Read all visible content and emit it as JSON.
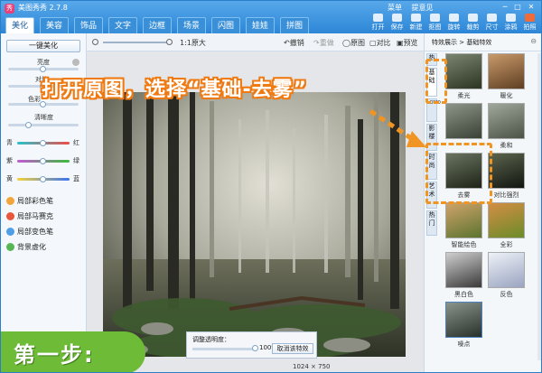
{
  "app": {
    "title": "美图秀秀 2.7.8",
    "logo_letter": "秀"
  },
  "top_links": [
    "菜单",
    "提意见"
  ],
  "window_controls": [
    "─",
    "□",
    "✕"
  ],
  "main_tabs": [
    "美化",
    "美容",
    "饰品",
    "文字",
    "边框",
    "场景",
    "闪图",
    "娃娃",
    "拼图"
  ],
  "toolbar_buttons": [
    "打开",
    "保存",
    "新建",
    "抠图",
    "旋转",
    "裁剪",
    "尺寸",
    "涂鸦",
    "拍照"
  ],
  "left_panel": {
    "onekey_label": "一键美化",
    "sliders": [
      {
        "label": "亮度",
        "level": 0.5
      },
      {
        "label": "对比",
        "level": 0.5
      },
      {
        "label": "色彩",
        "level": 0.5
      },
      {
        "label": "清晰度",
        "level": 0.3
      }
    ],
    "color_sliders": [
      {
        "left": "青",
        "right": "红",
        "level": 0.5,
        "gradient": "linear-gradient(90deg,#27c3c9,#f04a4a)"
      },
      {
        "left": "紫",
        "right": "绿",
        "level": 0.5,
        "gradient": "linear-gradient(90deg,#c05ad1,#3dbb3d)"
      },
      {
        "left": "黄",
        "right": "蓝",
        "level": 0.5,
        "gradient": "linear-gradient(90deg,#f2d23a,#3a74f2)"
      }
    ],
    "tools": [
      {
        "label": "局部彩色笔",
        "color": "#f2a53a"
      },
      {
        "label": "局部马赛克",
        "color": "#e8573c"
      },
      {
        "label": "局部变色笔",
        "color": "#4e9ee8"
      },
      {
        "label": "背景虚化",
        "color": "#55b653"
      }
    ]
  },
  "canvas_toolbar": {
    "zoom_label": "1:1原大",
    "undo": "撤销",
    "redo": "重做",
    "original": "原图",
    "compare": "对比",
    "preview": "预览"
  },
  "canvas": {
    "opacity_label": "调整透明度：",
    "opacity_value": "100%",
    "opacity_level": 1.0,
    "cancel_effect": "取消该特效",
    "dimensions": "1024 × 750"
  },
  "right_panel": {
    "breadcrumb": "特效展示 > 基础特效",
    "close_glyph": "⊖",
    "side_tabs": [
      "热",
      "基础",
      "LOMO",
      "影楼",
      "时尚",
      "艺术",
      "热门"
    ],
    "thumbs": [
      {
        "label": "柔光",
        "c1": "#7a8570",
        "c2": "#2c3422"
      },
      {
        "label": "暖化",
        "c1": "#c99a6a",
        "c2": "#5e3e22"
      },
      {
        "label": "",
        "c1": "#8c9688",
        "c2": "#3a4136"
      },
      {
        "label": "柔和",
        "c1": "#9fa89a",
        "c2": "#4b5347"
      },
      {
        "label": "去雾",
        "c1": "#6a7460",
        "c2": "#1e2418"
      },
      {
        "label": "对比强烈",
        "c1": "#5d654e",
        "c2": "#111510"
      },
      {
        "label": "智能绘色",
        "c1": "#d0a36a",
        "c2": "#5c7430"
      },
      {
        "label": "全彩",
        "c1": "#d48d45",
        "c2": "#6b8c2a"
      },
      {
        "label": "黑白色",
        "c1": "#cfcfcf",
        "c2": "#3a3a3a"
      },
      {
        "label": "反色",
        "c1": "#eef1f8",
        "c2": "#9aa4c0"
      },
      {
        "label": "噪点",
        "c1": "#8a948a",
        "c2": "#28302a"
      }
    ]
  },
  "annotation": {
    "callout": "打开原图，选择“基础-去雾”",
    "step": "第一步:"
  }
}
